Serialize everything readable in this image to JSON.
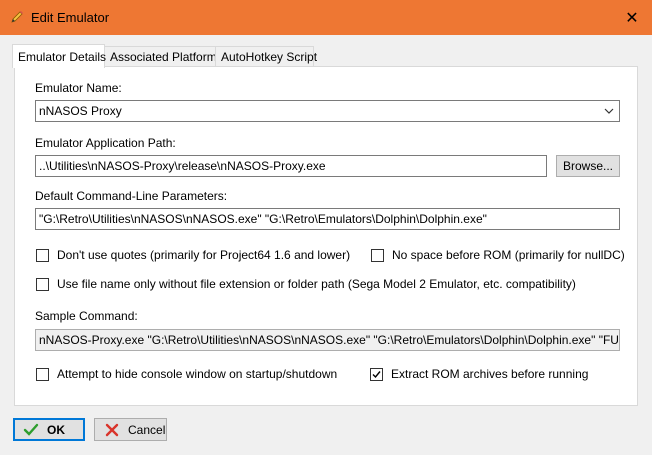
{
  "window": {
    "title": "Edit Emulator",
    "title_icon": "pencil-icon",
    "close_glyph": "✕"
  },
  "tabs": [
    {
      "label": "Emulator Details",
      "active": true
    },
    {
      "label": "Associated Platforms",
      "active": false
    },
    {
      "label": "AutoHotkey Script",
      "active": false
    }
  ],
  "details": {
    "name_label": "Emulator Name:",
    "name_value": "nNASOS Proxy",
    "path_label": "Emulator Application Path:",
    "path_value": "..\\Utilities\\nNASOS-Proxy\\release\\nNASOS-Proxy.exe",
    "browse_label": "Browse...",
    "params_label": "Default Command-Line Parameters:",
    "params_value": "\"G:\\Retro\\Utilities\\nNASOS\\nNASOS.exe\" \"G:\\Retro\\Emulators\\Dolphin\\Dolphin.exe\"",
    "checks": {
      "no_quotes": {
        "label": "Don't use quotes (primarily for Project64 1.6 and lower)",
        "checked": false
      },
      "no_space": {
        "label": "No space before ROM (primarily for nullDC)",
        "checked": false
      },
      "filename_only": {
        "label": "Use file name only without file extension or folder path (Sega Model 2 Emulator, etc. compatibility)",
        "checked": false
      },
      "hide_console": {
        "label": "Attempt to hide console window on startup/shutdown",
        "checked": false
      },
      "extract_rom": {
        "label": "Extract ROM archives before running",
        "checked": true
      }
    },
    "sample_label": "Sample Command:",
    "sample_value": "nNASOS-Proxy.exe \"G:\\Retro\\Utilities\\nNASOS\\nNASOS.exe\" \"G:\\Retro\\Emulators\\Dolphin\\Dolphin.exe\" \"FULL\\PATH\\TO\\"
  },
  "footer": {
    "ok_label": "OK",
    "cancel_label": "Cancel"
  },
  "colors": {
    "titlebar": "#ee7733",
    "ok_check": "#2e9e2e",
    "cancel_x": "#d9342b"
  }
}
